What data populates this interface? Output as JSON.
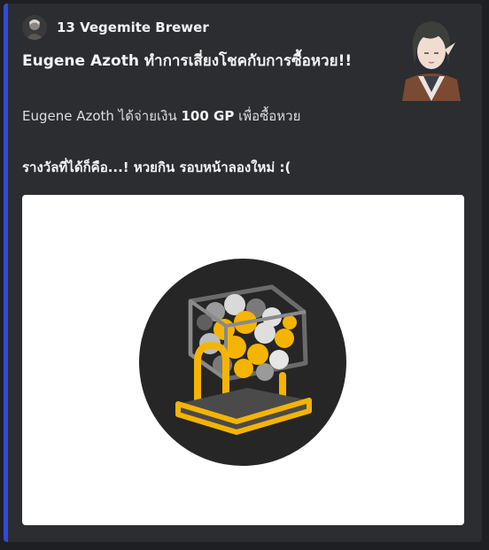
{
  "embed": {
    "accent_color": "#2f4bd8",
    "author": {
      "name": "13 Vegemite Brewer",
      "icon": "author-avatar-icon"
    },
    "title": "Eugene Azoth ทำการเสี่ยงโชคกับการซื้อหวย!!",
    "description": {
      "prefix": "Eugene Azoth ได้จ่ายเงิน ",
      "amount": "100 GP",
      "suffix": " เพื่อซื้อหวย"
    },
    "prize_line": "รางวัลที่ได้ก็คือ...! หวยกิน รอบหน้าลองใหม่ :(",
    "thumbnail": "character-portrait-image",
    "image": "lottery-machine-icon",
    "colors": {
      "background": "#2b2d31",
      "image_card": "#ffffff",
      "icon_circle": "#262626",
      "icon_yellow": "#f5b400"
    }
  }
}
